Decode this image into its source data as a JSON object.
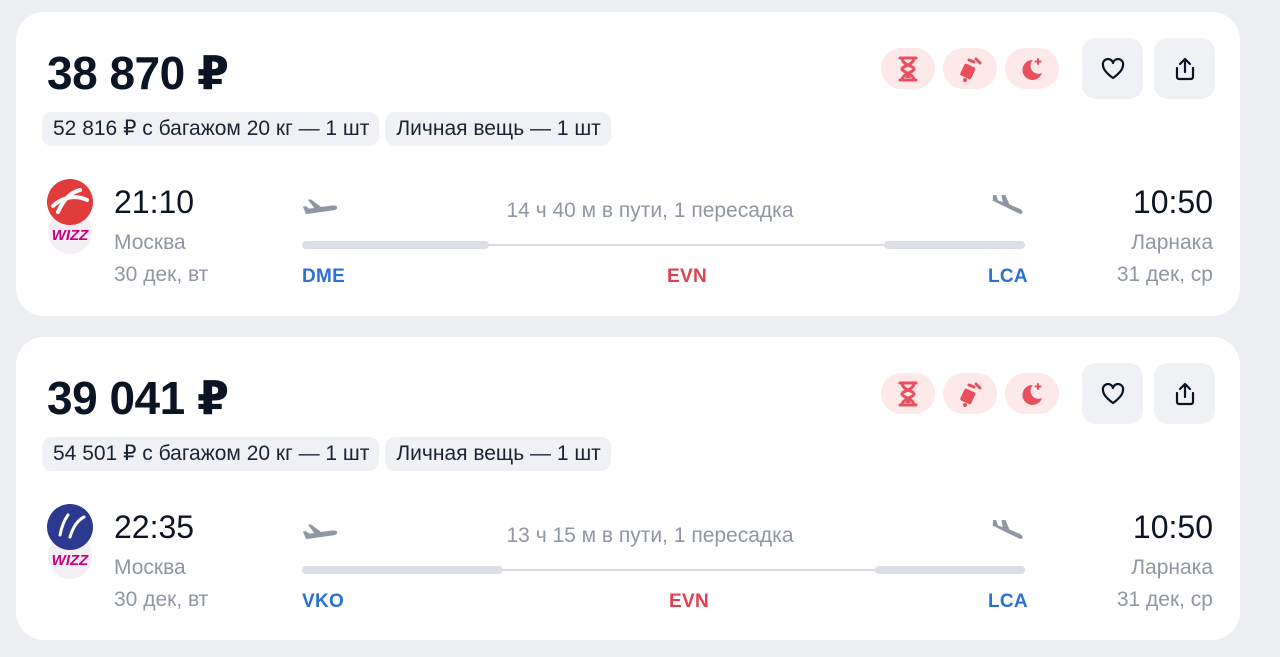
{
  "colors": {
    "background": "#eceef2",
    "card": "#ffffff",
    "badge_bg": "#fde8ea",
    "badge_icon": "#e8505e",
    "airport_blue": "#2d6fd6",
    "airport_red": "#e0414f"
  },
  "badges": [
    "hourglass-icon",
    "luggage-icon",
    "moon-icon"
  ],
  "actions": [
    "heart-icon",
    "share-icon"
  ],
  "offers": [
    {
      "price": "38 870 ₽",
      "chips": [
        "52 816 ₽ с багажом 20 кг — 1 шт",
        "Личная вещь — 1 шт"
      ],
      "airline_logo": "wizz-logo-red",
      "departure": {
        "time": "21:10",
        "city": "Москва",
        "date": "30 дек, вт",
        "airport": "DME"
      },
      "duration": "14 ч 40 м в пути, 1 пересадка",
      "transfer_airport": "EVN",
      "arrival": {
        "time": "10:50",
        "city": "Ларнака",
        "date": "31 дек, ср",
        "airport": "LCA"
      }
    },
    {
      "price": "39 041 ₽",
      "chips": [
        "54 501 ₽ с багажом 20 кг — 1 шт",
        "Личная вещь — 1 шт"
      ],
      "airline_logo": "wizz-logo-blue",
      "departure": {
        "time": "22:35",
        "city": "Москва",
        "date": "30 дек, вт",
        "airport": "VKO"
      },
      "duration": "13 ч 15 м в пути, 1 пересадка",
      "transfer_airport": "EVN",
      "arrival": {
        "time": "10:50",
        "city": "Ларнака",
        "date": "31 дек, ср",
        "airport": "LCA"
      }
    }
  ]
}
